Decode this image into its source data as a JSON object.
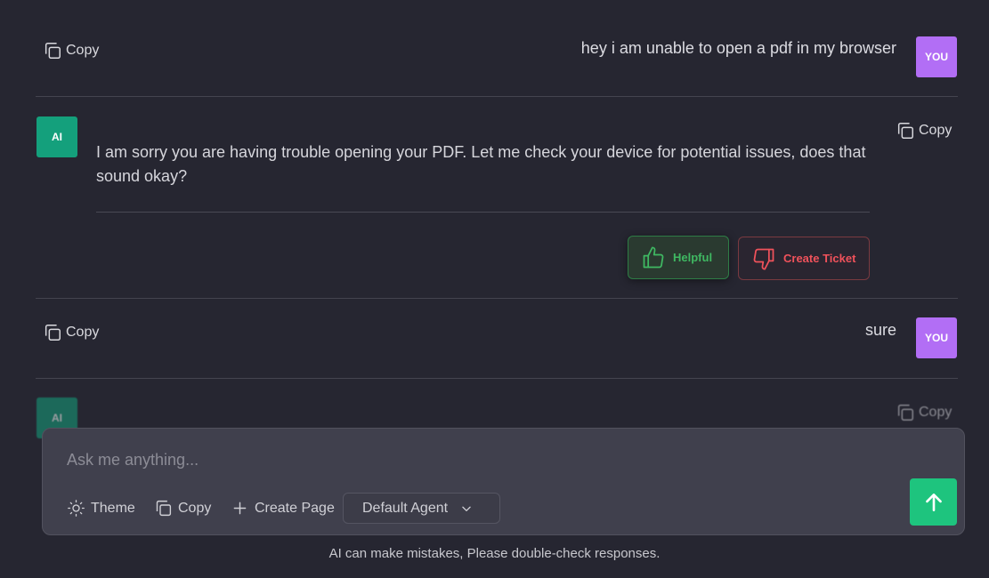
{
  "messages": [
    {
      "role": "user",
      "avatar_label": "YOU",
      "text": "hey i am unable to open a pdf in my browser",
      "copy_label": "Copy"
    },
    {
      "role": "ai",
      "avatar_label": "AI",
      "text": "I am sorry you are having trouble opening your PDF. Let me check your device for potential issues, does that sound okay?",
      "copy_label": "Copy",
      "helpful_label": "Helpful",
      "ticket_label": "Create Ticket"
    },
    {
      "role": "user",
      "avatar_label": "YOU",
      "text": "sure",
      "copy_label": "Copy"
    },
    {
      "role": "ai",
      "avatar_label": "AI",
      "copy_label": "Copy"
    }
  ],
  "composer": {
    "placeholder": "Ask me anything...",
    "value": "",
    "theme_label": "Theme",
    "copy_label": "Copy",
    "create_page_label": "Create Page",
    "agent_selected": "Default Agent"
  },
  "disclaimer": "AI can make mistakes, Please double-check responses.",
  "colors": {
    "background": "#262631",
    "user_avatar": "#b26ef5",
    "ai_avatar": "#14a07c",
    "helpful": "#3fb862",
    "ticket": "#f0525b",
    "send": "#1ec47e"
  }
}
